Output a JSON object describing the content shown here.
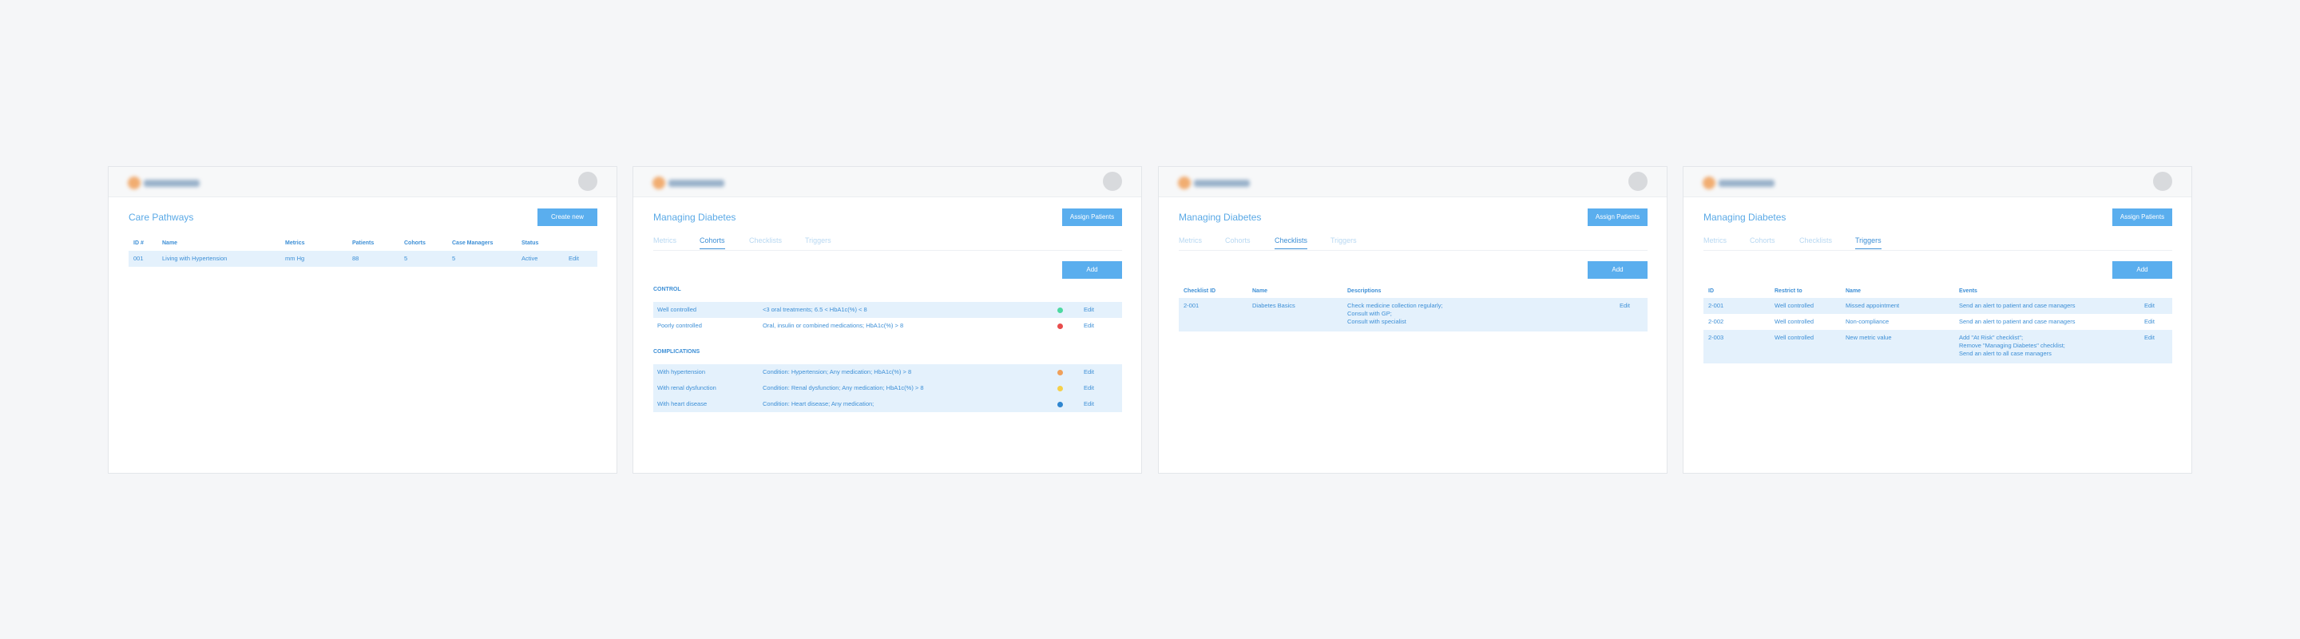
{
  "panel1": {
    "title": "Care Pathways",
    "create_label": "Create new",
    "columns": [
      "ID #",
      "Name",
      "Metrics",
      "Patients",
      "Cohorts",
      "Case Managers",
      "Status"
    ],
    "rows": [
      {
        "id": "001",
        "name": "Living with Hypertension",
        "metrics": "mm Hg",
        "patients": "88",
        "cohorts": "5",
        "case_managers": "5",
        "status": "Active",
        "edit": "Edit"
      }
    ]
  },
  "panel2": {
    "title": "Managing Diabetes",
    "assign_label": "Assign Patients",
    "add_label": "Add",
    "tabs": [
      "Metrics",
      "Cohorts",
      "Checklists",
      "Triggers"
    ],
    "active_tab": "Cohorts",
    "control_section": "CONTROL",
    "complications_section": "COMPLICATIONS",
    "control_rows": [
      {
        "name": "Well controlled",
        "desc": "<3 oral treatments; 6.5 < HbA1c(%) < 8",
        "color": "#4cd9a0",
        "edit": "Edit"
      },
      {
        "name": "Poorly controlled",
        "desc": "Oral, insulin or combined medications; HbA1c(%) > 8",
        "color": "#e84c4c",
        "edit": "Edit"
      }
    ],
    "complication_rows": [
      {
        "name": "With hypertension",
        "desc": "Condition: Hypertension; Any medication; HbA1c(%) > 8",
        "color": "#f0a05a",
        "edit": "Edit"
      },
      {
        "name": "With renal dysfunction",
        "desc": "Condition: Renal dysfunction; Any medication; HbA1c(%) > 8",
        "color": "#f5d04a",
        "edit": "Edit"
      },
      {
        "name": "With heart disease",
        "desc": "Condition: Heart disease; Any medication;",
        "color": "#2f86d0",
        "edit": "Edit"
      }
    ]
  },
  "panel3": {
    "title": "Managing Diabetes",
    "assign_label": "Assign Patients",
    "add_label": "Add",
    "tabs": [
      "Metrics",
      "Cohorts",
      "Checklists",
      "Triggers"
    ],
    "active_tab": "Checklists",
    "columns": [
      "Checklist ID",
      "Name",
      "Descriptions"
    ],
    "rows": [
      {
        "id": "2-001",
        "name": "Diabetes Basics",
        "desc": [
          "Check medicine collection regularly;",
          "Consult with GP;",
          "Consult with specialist"
        ],
        "edit": "Edit"
      }
    ]
  },
  "panel4": {
    "title": "Managing Diabetes",
    "assign_label": "Assign Patients",
    "add_label": "Add",
    "tabs": [
      "Metrics",
      "Cohorts",
      "Checklists",
      "Triggers"
    ],
    "active_tab": "Triggers",
    "columns": [
      "ID",
      "Restrict to",
      "Name",
      "Events"
    ],
    "rows": [
      {
        "id": "2-001",
        "restrict": "Well controlled",
        "name": "Missed appointment",
        "events": [
          "Send an alert to patient and case managers"
        ],
        "edit": "Edit"
      },
      {
        "id": "2-002",
        "restrict": "Well controlled",
        "name": "Non-compliance",
        "events": [
          "Send an alert to patient and case managers"
        ],
        "edit": "Edit"
      },
      {
        "id": "2-003",
        "restrict": "Well controlled",
        "name": "New metric value",
        "events": [
          "Add \"At Risk\" checklist\";",
          "Remove \"Managing Diabetes\" checklist;",
          "Send an alert to all case managers"
        ],
        "edit": "Edit"
      }
    ]
  }
}
